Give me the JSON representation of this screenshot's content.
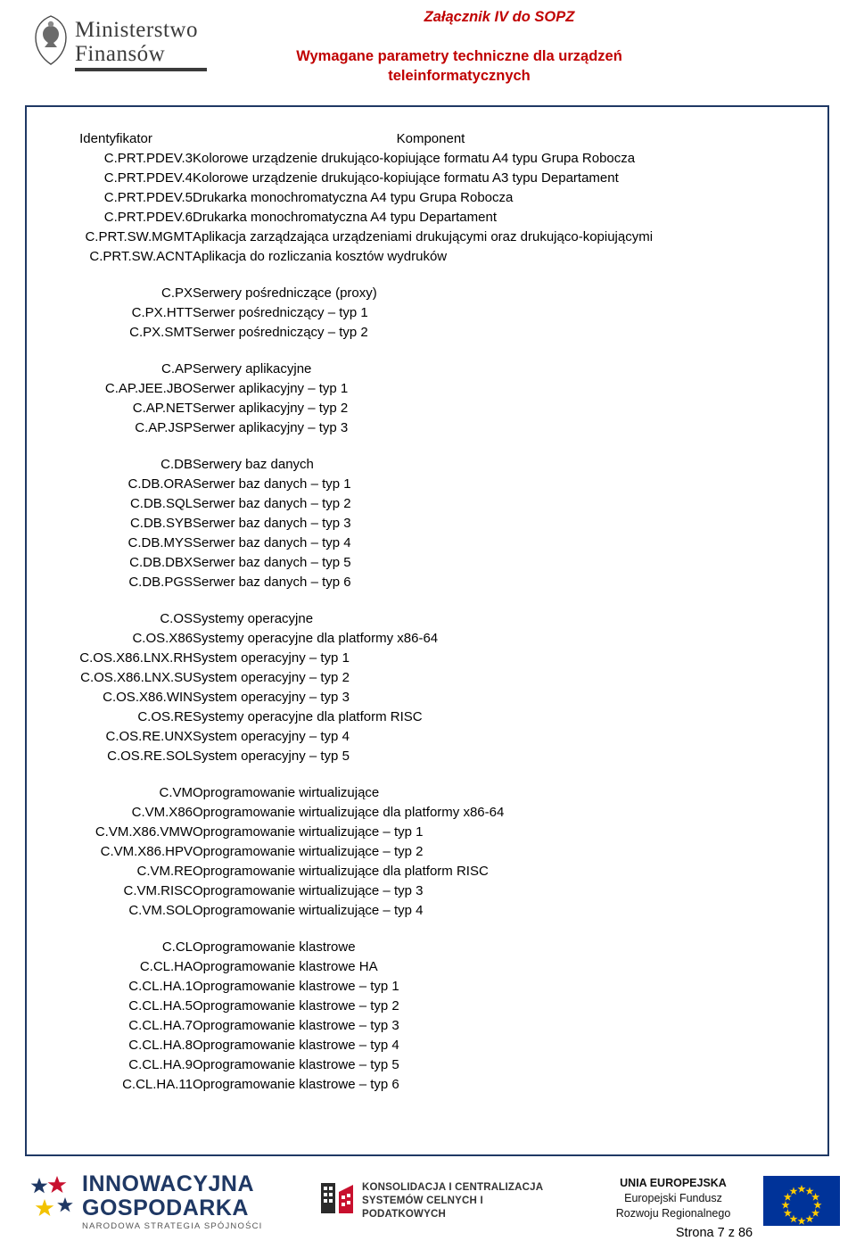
{
  "header": {
    "logo": {
      "line1": "Ministerstwo",
      "line2": "Finansów",
      "crest_icon": "polish-eagle-crest-icon"
    },
    "annex": "Załącznik IV do SOPZ",
    "title_line1": "Wymagane parametry techniczne dla urządzeń",
    "title_line2": "teleinformatycznych",
    "accent_color": "#c00000",
    "border_color": "#1f3864"
  },
  "table": {
    "columns": [
      "Identyfikator",
      "Komponent"
    ],
    "rows": [
      {
        "id": "C.PRT.PDEV.3",
        "cmp": "Kolorowe urządzenie drukująco-kopiujące formatu A4 typu Grupa Robocza",
        "bold": false
      },
      {
        "id": "C.PRT.PDEV.4",
        "cmp": "Kolorowe urządzenie drukująco-kopiujące formatu A3 typu Departament",
        "bold": false
      },
      {
        "id": "C.PRT.PDEV.5",
        "cmp": "Drukarka monochromatyczna A4 typu Grupa Robocza",
        "bold": false
      },
      {
        "id": "C.PRT.PDEV.6",
        "cmp": "Drukarka monochromatyczna A4 typu Departament",
        "bold": false
      },
      {
        "id": "C.PRT.SW.MGMT",
        "cmp": "Aplikacja zarządzająca urządzeniami drukującymi oraz drukująco-kopiującymi",
        "bold": false
      },
      {
        "id": "C.PRT.SW.ACNT",
        "cmp": "Aplikacja do rozliczania kosztów wydruków",
        "bold": false
      },
      {
        "spacer": true
      },
      {
        "id": "C.PX",
        "cmp": "Serwery pośredniczące (proxy)",
        "bold": true
      },
      {
        "id": "C.PX.HTT",
        "cmp": "Serwer pośredniczący – typ 1",
        "bold": false
      },
      {
        "id": "C.PX.SMT",
        "cmp": "Serwer pośredniczący – typ 2",
        "bold": false
      },
      {
        "spacer": true
      },
      {
        "id": "C.AP",
        "cmp": "Serwery aplikacyjne",
        "bold": true
      },
      {
        "id": "C.AP.JEE.JBO",
        "cmp": "Serwer aplikacyjny – typ 1",
        "bold": false
      },
      {
        "id": "C.AP.NET",
        "cmp": "Serwer aplikacyjny – typ 2",
        "bold": false
      },
      {
        "id": "C.AP.JSP",
        "cmp": "Serwer aplikacyjny – typ 3",
        "bold": false
      },
      {
        "spacer": true
      },
      {
        "id": "C.DB",
        "cmp": "Serwery baz danych",
        "bold": true
      },
      {
        "id": "C.DB.ORA",
        "cmp": "Serwer baz danych – typ 1",
        "bold": false
      },
      {
        "id": "C.DB.SQL",
        "cmp": "Serwer baz danych – typ 2",
        "bold": false
      },
      {
        "id": "C.DB.SYB",
        "cmp": "Serwer baz danych – typ 3",
        "bold": false
      },
      {
        "id": "C.DB.MYS",
        "cmp": "Serwer baz danych – typ 4",
        "bold": false
      },
      {
        "id": "C.DB.DBX",
        "cmp": "Serwer baz danych – typ 5",
        "bold": false
      },
      {
        "id": "C.DB.PGS",
        "cmp": "Serwer baz danych – typ 6",
        "bold": false
      },
      {
        "spacer": true
      },
      {
        "id": "C.OS",
        "cmp": "Systemy operacyjne",
        "bold": true
      },
      {
        "id": "C.OS.X86",
        "cmp": "Systemy operacyjne dla platformy x86-64",
        "bold": false
      },
      {
        "id": "C.OS.X86.LNX.RH",
        "cmp": "System operacyjny – typ 1",
        "bold": false
      },
      {
        "id": "C.OS.X86.LNX.SU",
        "cmp": "System operacyjny – typ 2",
        "bold": false
      },
      {
        "id": "C.OS.X86.WIN",
        "cmp": "System operacyjny – typ 3",
        "bold": false
      },
      {
        "id": "C.OS.RE",
        "cmp": "Systemy operacyjne dla platform RISC",
        "bold": false
      },
      {
        "id": "C.OS.RE.UNX",
        "cmp": "System operacyjny – typ 4",
        "bold": false
      },
      {
        "id": "C.OS.RE.SOL",
        "cmp": "System operacyjny – typ 5",
        "bold": false
      },
      {
        "spacer": true
      },
      {
        "id": "C.VM",
        "cmp": "Oprogramowanie wirtualizujące",
        "bold": true
      },
      {
        "id": "C.VM.X86",
        "cmp": "Oprogramowanie wirtualizujące dla platformy x86-64",
        "bold": false
      },
      {
        "id": "C.VM.X86.VMW",
        "cmp": "Oprogramowanie wirtualizujące – typ 1",
        "bold": false
      },
      {
        "id": "C.VM.X86.HPV",
        "cmp": "Oprogramowanie wirtualizujące – typ 2",
        "bold": false
      },
      {
        "id": "C.VM.RE",
        "cmp": "Oprogramowanie wirtualizujące dla platform RISC",
        "bold": false
      },
      {
        "id": "C.VM.RISC",
        "cmp": "Oprogramowanie wirtualizujące – typ 3",
        "bold": false
      },
      {
        "id": "C.VM.SOL",
        "cmp": "Oprogramowanie wirtualizujące – typ 4",
        "bold": false
      },
      {
        "spacer": true
      },
      {
        "id": "C.CL",
        "cmp": "Oprogramowanie klastrowe",
        "bold": true
      },
      {
        "id": "C.CL.HA",
        "cmp": "Oprogramowanie klastrowe HA",
        "bold": false
      },
      {
        "id": "C.CL.HA.1",
        "cmp": "Oprogramowanie klastrowe – typ 1",
        "bold": false
      },
      {
        "id": "C.CL.HA.5",
        "cmp": "Oprogramowanie klastrowe – typ 2",
        "bold": false
      },
      {
        "id": "C.CL.HA.7",
        "cmp": "Oprogramowanie klastrowe – typ 3",
        "bold": false
      },
      {
        "id": "C.CL.HA.8",
        "cmp": "Oprogramowanie klastrowe – typ 4",
        "bold": false
      },
      {
        "id": "C.CL.HA.9",
        "cmp": "Oprogramowanie klastrowe – typ 5",
        "bold": false
      },
      {
        "id": "C.CL.HA.11",
        "cmp": "Oprogramowanie klastrowe – typ 6",
        "bold": false
      }
    ]
  },
  "footer": {
    "innowacyjna": {
      "line1": "INNOWACYJNA",
      "line2": "GOSPODARKA",
      "line3": "NARODOWA STRATEGIA SPÓJNOŚCI",
      "stars_icon": "innowacyjna-stars-icon"
    },
    "konsolidacja": {
      "line1": "KONSOLIDACJA I CENTRALIZACJA",
      "line2": "SYSTEMÓW CELNYCH I PODATKOWYCH",
      "icon": "konsolidacja-project-icon"
    },
    "eu": {
      "line1": "UNIA EUROPEJSKA",
      "line2": "Europejski Fundusz",
      "line3": "Rozwoju Regionalnego",
      "flag_icon": "eu-flag-icon"
    },
    "page_number": "Strona 7 z 86"
  }
}
